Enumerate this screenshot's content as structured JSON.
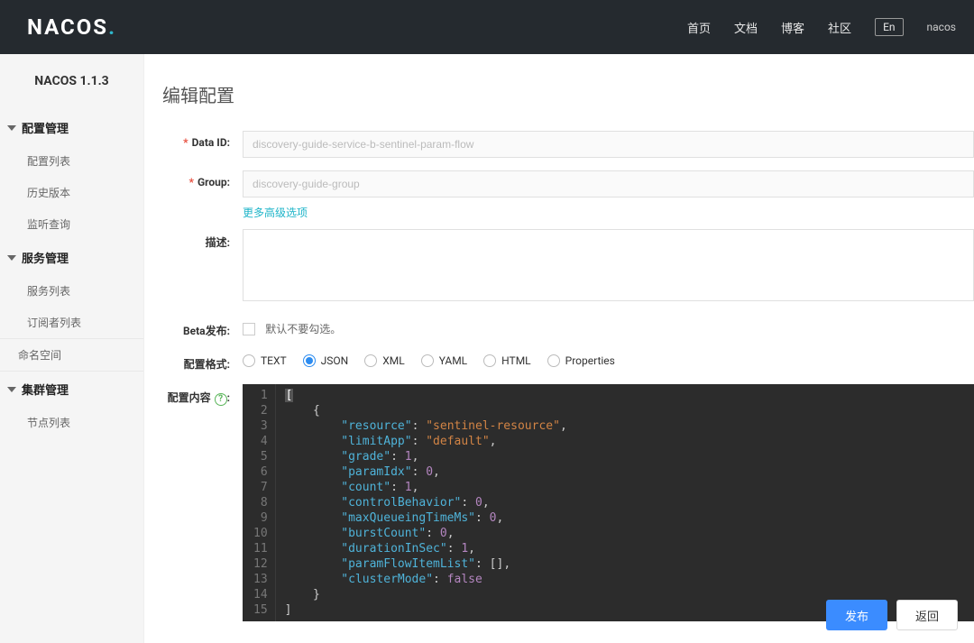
{
  "header": {
    "logo_main": "NACOS",
    "logo_dot": ".",
    "nav": {
      "home": "首页",
      "docs": "文档",
      "blog": "博客",
      "community": "社区",
      "lang": "En",
      "user": "nacos"
    }
  },
  "sidebar": {
    "version": "NACOS 1.1.3",
    "groups": [
      {
        "title": "配置管理",
        "items": [
          "配置列表",
          "历史版本",
          "监听查询"
        ]
      },
      {
        "title": "服务管理",
        "items": [
          "服务列表",
          "订阅者列表"
        ]
      }
    ],
    "namespace": "命名空间",
    "cluster": {
      "title": "集群管理",
      "items": [
        "节点列表"
      ]
    }
  },
  "page": {
    "title": "编辑配置",
    "labels": {
      "dataId": "Data ID:",
      "group": "Group:",
      "desc": "描述:",
      "beta": "Beta发布:",
      "format": "配置格式:",
      "content": "配置内容"
    },
    "form": {
      "dataId": "discovery-guide-service-b-sentinel-param-flow",
      "group": "discovery-guide-group",
      "advancedLink": "更多高级选项",
      "desc": "",
      "betaHint": "默认不要勾选。"
    },
    "formats": [
      "TEXT",
      "JSON",
      "XML",
      "YAML",
      "HTML",
      "Properties"
    ],
    "selectedFormat": "JSON",
    "help": "?",
    "colon": ":",
    "footer": {
      "publish": "发布",
      "back": "返回"
    }
  },
  "editor": {
    "lines": 15,
    "config": {
      "resource": "sentinel-resource",
      "limitApp": "default",
      "grade": 1,
      "paramIdx": 0,
      "count": 1,
      "controlBehavior": 0,
      "maxQueueingTimeMs": 0,
      "burstCount": 0,
      "durationInSec": 1,
      "paramFlowItemList": "[]",
      "clusterMode": "false"
    }
  }
}
